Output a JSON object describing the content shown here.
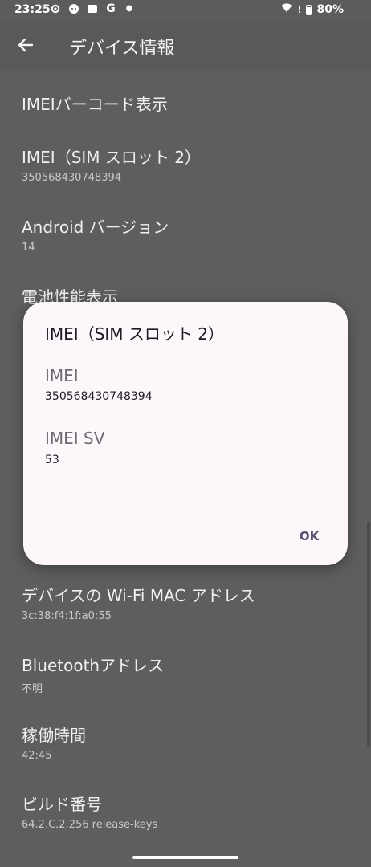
{
  "status_bar": {
    "time": "23:25",
    "battery_percent": "80%",
    "battery_level": 0.8
  },
  "app_bar": {
    "title": "デバイス情報"
  },
  "list": {
    "items": [
      {
        "title": "IMEIバーコード表示",
        "sub": ""
      },
      {
        "title": "IMEI（SIM スロット 2）",
        "sub": "350568430748394"
      },
      {
        "title": "Android バージョン",
        "sub": "14"
      },
      {
        "title": "電池性能表示",
        "sub": ""
      },
      {
        "title": "デバイスの Wi-Fi MAC アドレス",
        "sub": "3c:38:f4:1f:a0:55"
      },
      {
        "title": "Bluetoothアドレス",
        "sub": "不明"
      },
      {
        "title": "稼働時間",
        "sub": "42:45"
      },
      {
        "title": "ビルド番号",
        "sub": "64.2.C.2.256 release-keys"
      }
    ]
  },
  "dialog": {
    "title": "IMEI（SIM スロット 2）",
    "imei_label": "IMEI",
    "imei_value": "350568430748394",
    "imei_sv_label": "IMEI SV",
    "imei_sv_value": "53",
    "ok_label": "OK"
  },
  "icons": {
    "back": "arrow-back-icon",
    "settings": "gear-icon",
    "game": "gamepad-icon",
    "google": "google-icon",
    "wifi": "wifi-icon",
    "battery": "battery-icon"
  }
}
